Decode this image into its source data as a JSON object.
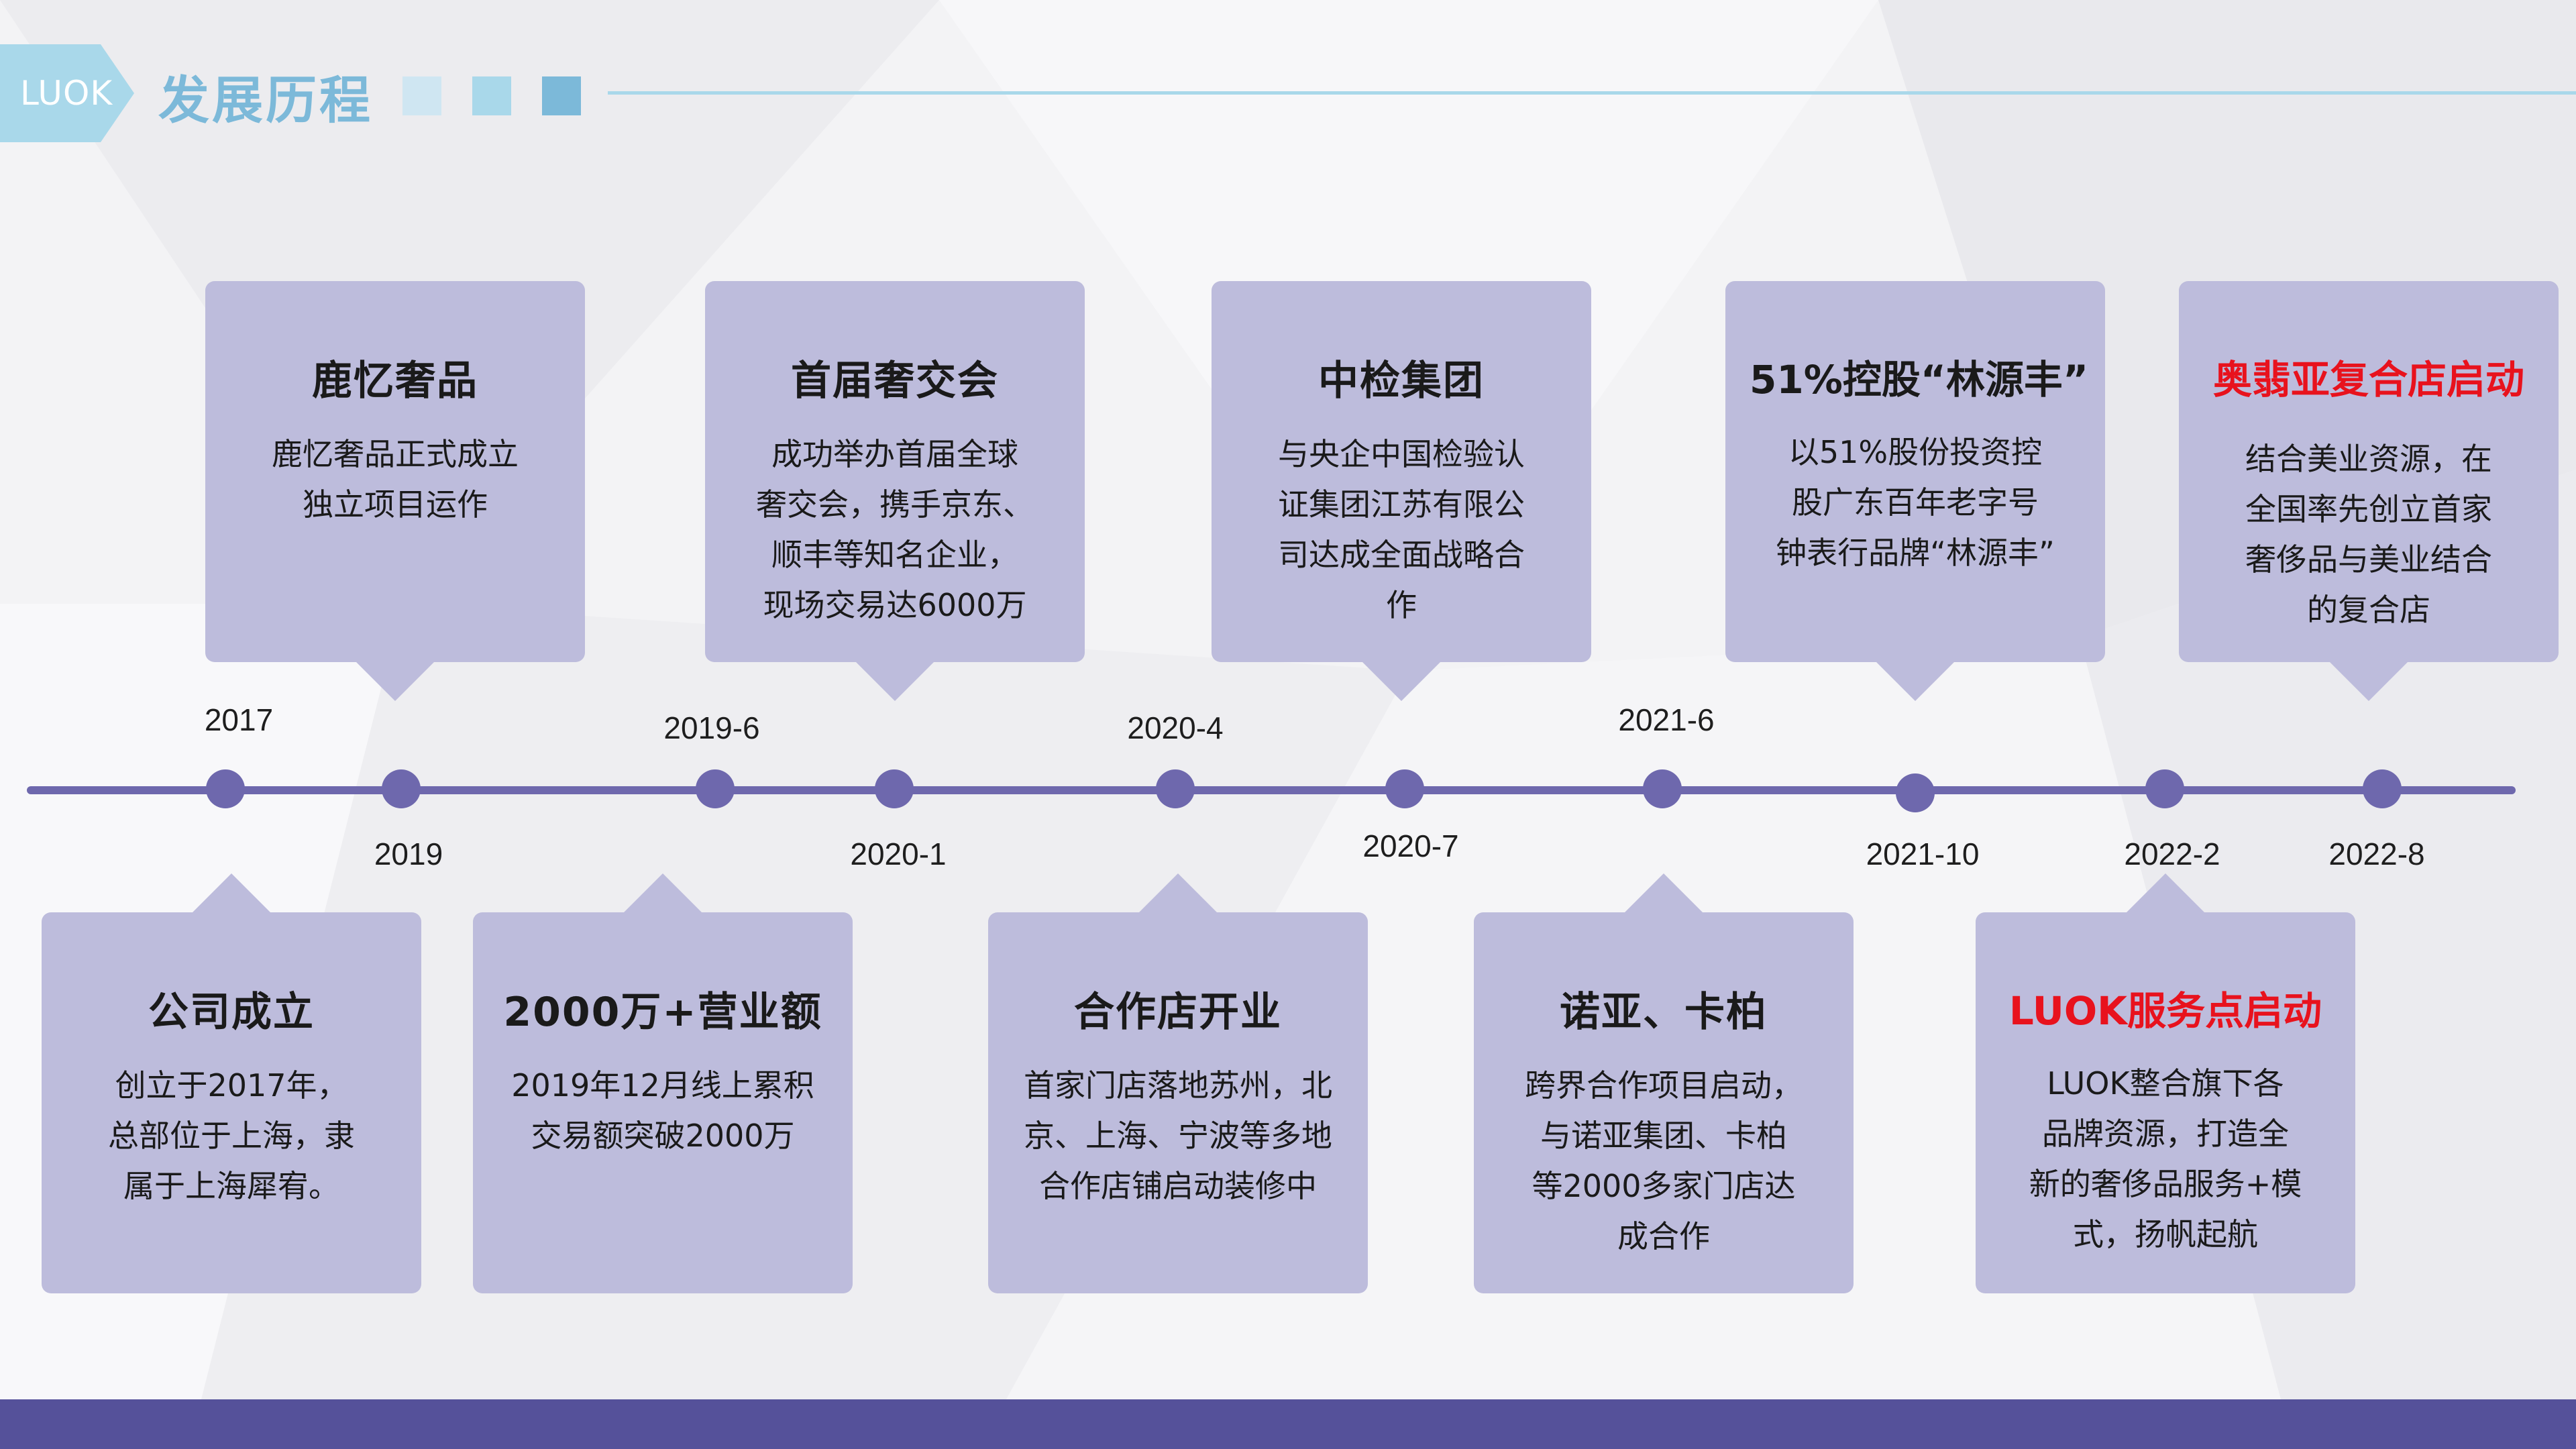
{
  "header": {
    "logo": "LUOK",
    "title": "发展历程",
    "square_colors": [
      "#cfe6f2",
      "#a9d8ea",
      "#7cb9d9"
    ],
    "line_color": "#a9d8ea"
  },
  "timeline": {
    "line_color": "#6e68ad",
    "years": [
      "2017",
      "2019",
      "2019-6",
      "2020-1",
      "2020-4",
      "2020-7",
      "2021-6",
      "2021-10",
      "2022-2",
      "2022-8"
    ]
  },
  "cards_top": [
    {
      "title": "鹿忆奢品",
      "lines": [
        "鹿忆奢品正式成立",
        "独立项目运作"
      ],
      "title_color": "#1a1a1a"
    },
    {
      "title": "首届奢交会",
      "lines": [
        "成功举办首届全球",
        "奢交会，携手京东、",
        "顺丰等知名企业，",
        "现场交易达6000万"
      ],
      "title_color": "#1a1a1a"
    },
    {
      "title": "中检集团",
      "lines": [
        "与央企中国检验认",
        "证集团江苏有限公",
        "司达成全面战略合",
        "作"
      ],
      "title_color": "#1a1a1a"
    },
    {
      "title": "51%控股“林源丰”",
      "lines": [
        "以51%股份投资控",
        "股广东百年老字号",
        "钟表行品牌“林源丰”"
      ],
      "title_color": "#1a1a1a"
    },
    {
      "title": "奥翡亚复合店启动",
      "lines": [
        "结合美业资源，在",
        "全国率先创立首家",
        "奢侈品与美业结合",
        "的复合店"
      ],
      "title_color": "#e8121d"
    }
  ],
  "cards_bottom": [
    {
      "title": "公司成立",
      "lines": [
        "创立于2017年，",
        "总部位于上海，隶",
        "属于上海犀宥。"
      ],
      "title_color": "#1a1a1a"
    },
    {
      "title": "2000万+营业额",
      "lines": [
        "2019年12月线上累积",
        "交易额突破2000万"
      ],
      "title_color": "#1a1a1a"
    },
    {
      "title": "合作店开业",
      "lines": [
        "首家门店落地苏州，北",
        "京、上海、宁波等多地",
        "合作店铺启动装修中"
      ],
      "title_color": "#1a1a1a"
    },
    {
      "title": "诺亚、卡柏",
      "lines": [
        "跨界合作项目启动，",
        "与诺亚集团、卡柏",
        "等2000多家门店达",
        "成合作"
      ],
      "title_color": "#1a1a1a"
    },
    {
      "title": "LUOK服务点启动",
      "lines": [
        "LUOK整合旗下各",
        "品牌资源，打造全",
        "新的奢侈品服务+模",
        "式，扬帆起航"
      ],
      "title_color": "#e8121d"
    }
  ],
  "footer": {
    "bar_color": "#55519a"
  }
}
